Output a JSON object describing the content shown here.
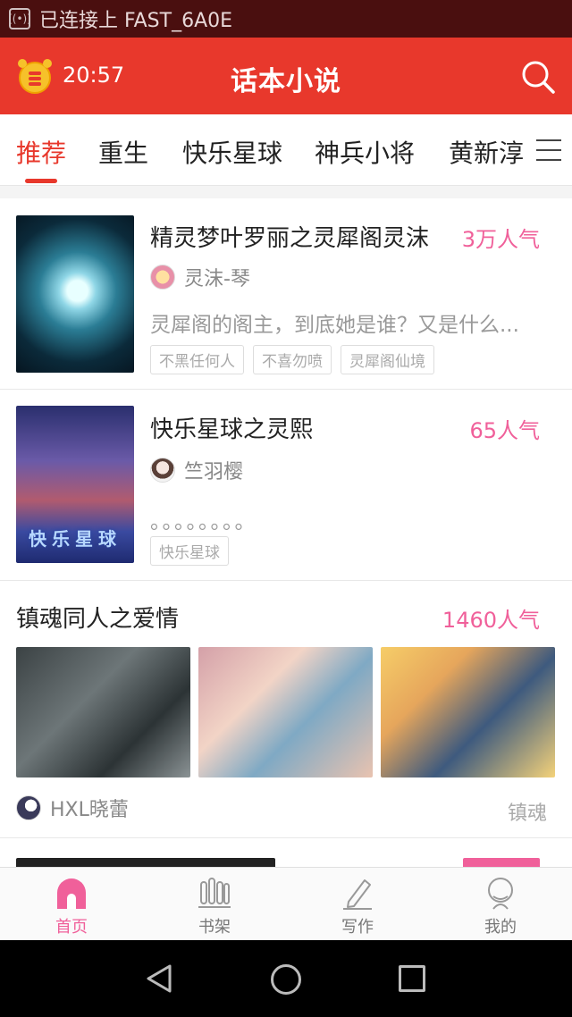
{
  "status_bar": {
    "wifi_text": "已连接上 FAST_6A0E"
  },
  "app_bar": {
    "time": "20:57",
    "title": "话本小说"
  },
  "tabs": [
    {
      "label": "推荐",
      "active": true
    },
    {
      "label": "重生",
      "active": false
    },
    {
      "label": "快乐星球",
      "active": false
    },
    {
      "label": "神兵小将",
      "active": false
    },
    {
      "label": "黄新淳",
      "active": false
    }
  ],
  "books": [
    {
      "title": "精灵梦叶罗丽之灵犀阁灵沫",
      "popularity": "3万人气",
      "author": "灵沫-琴",
      "description": "灵犀阁的阁主，到底她是谁？又是什么...",
      "tags": [
        "不黑任何人",
        "不喜勿喷",
        "灵犀阁仙境"
      ]
    },
    {
      "title": "快乐星球之灵熙",
      "popularity": "65人气",
      "author": "竺羽樱",
      "description": "。。。。。。。。",
      "tags": [
        "快乐星球"
      ],
      "cover_text": "快乐星球"
    }
  ],
  "featured": {
    "title": "镇魂同人之爱情",
    "popularity": "1460人气",
    "author": "HXL晓蕾",
    "category": "镇魂"
  },
  "bottom_nav": [
    {
      "label": "首页",
      "icon": "home-icon",
      "active": true
    },
    {
      "label": "书架",
      "icon": "bookshelf-icon",
      "active": false
    },
    {
      "label": "写作",
      "icon": "pencil-icon",
      "active": false
    },
    {
      "label": "我的",
      "icon": "profile-icon",
      "active": false
    }
  ],
  "colors": {
    "accent": "#e8382c",
    "pink": "#f0609a",
    "status_bar": "#4a0f0f"
  }
}
